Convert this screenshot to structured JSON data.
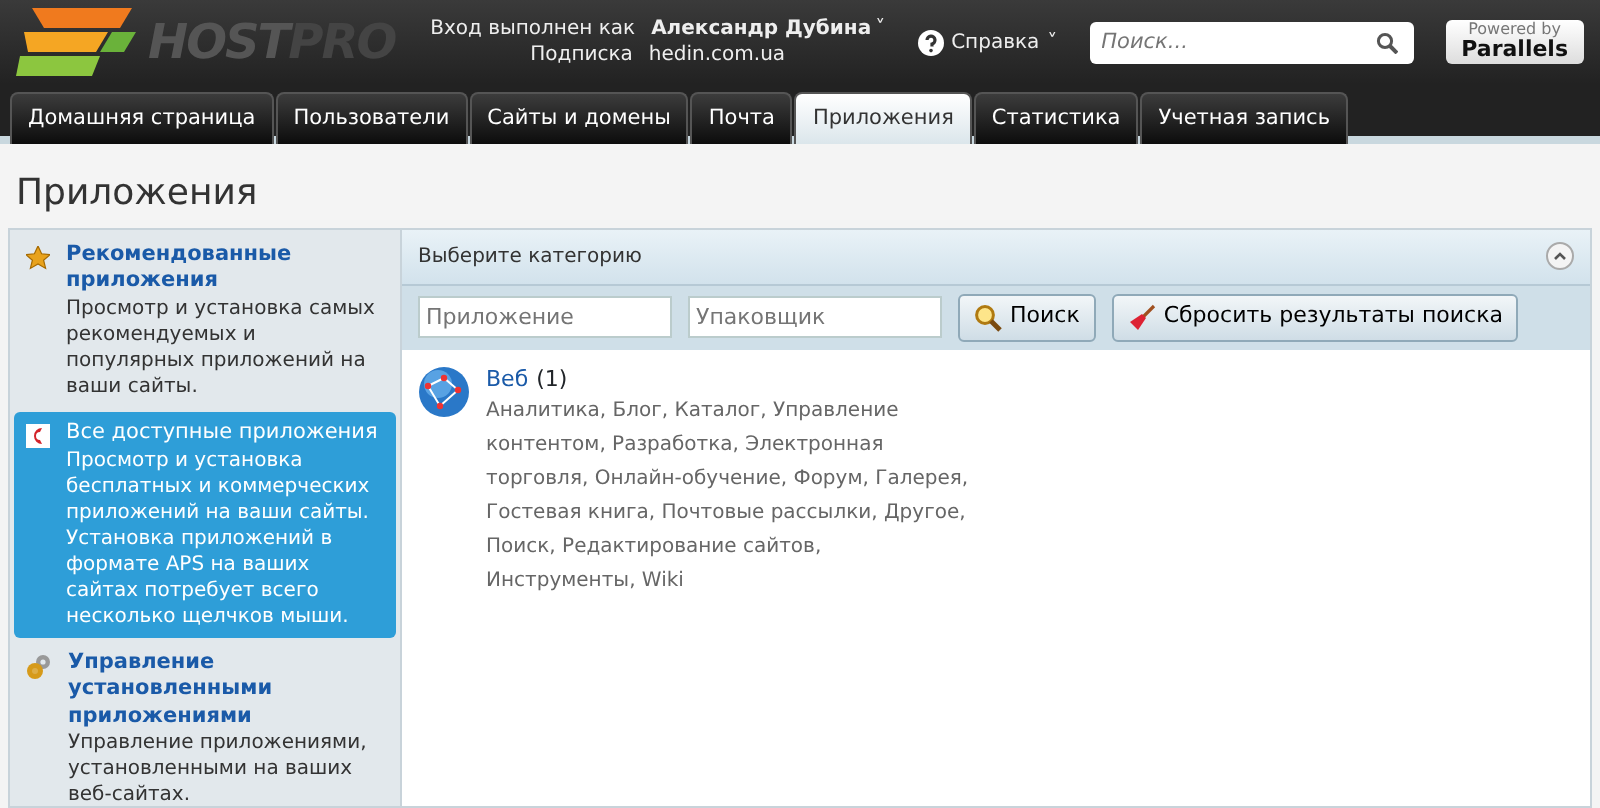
{
  "header": {
    "logo": {
      "part_1": "HOST",
      "part_2": "PRO"
    },
    "login_label": "Вход выполнен как",
    "user": "Александр Дубина",
    "user_caret": "˅",
    "subscription_label": "Подписка",
    "subscription": "hedin.com.ua",
    "help": "Справка",
    "help_caret": "˅",
    "search": {
      "placeholder": "Поиск..."
    },
    "powered": {
      "line_1": "Powered by",
      "line_2": "Parallels"
    }
  },
  "tabs": [
    {
      "label": "Домашняя страница",
      "selected": false
    },
    {
      "label": "Пользователи",
      "selected": false
    },
    {
      "label": "Сайты и домены",
      "selected": false
    },
    {
      "label": "Почта",
      "selected": false
    },
    {
      "label": "Приложения",
      "selected": true
    },
    {
      "label": "Статистика",
      "selected": false
    },
    {
      "label": "Учетная запись",
      "selected": false
    }
  ],
  "page_title": "Приложения",
  "sidebar": {
    "items": [
      {
        "kind": "star",
        "title": "Рекомендованные приложения",
        "description": "Просмотр и установка самых рекомендуемых и популярных приложений на ваши сайты.",
        "selected": false
      },
      {
        "kind": "catalog",
        "title": "Все доступные приложения",
        "description": "Просмотр и установка бесплатных и коммерческих приложений на ваши сайты. Установка приложений в формате APS на ваших сайтах потребует всего несколько щелчков мыши.",
        "selected": true
      },
      {
        "kind": "gears",
        "title": "Управление установленными приложениями",
        "description": "Управление приложениями, установленными на ваших веб-сайтах.",
        "selected": false
      }
    ]
  },
  "panel": {
    "title": "Выберите категорию",
    "filters": [
      {
        "placeholder": "Приложение"
      },
      {
        "placeholder": "Упаковщик"
      }
    ],
    "buttons": [
      {
        "kind": "search",
        "label": "Поиск"
      },
      {
        "kind": "reset",
        "label": "Сбросить результаты поиска"
      }
    ],
    "categories": [
      {
        "name": "Веб",
        "count": "(1)",
        "tags": "Аналитика, Блог, Каталог, Управление контентом, Разработка, Электронная торговля, Онлайн-обучение, Форум, Галерея, Гостевая книга, Почтовые рассылки, Другое, Поиск, Редактирование сайтов, Инструменты, Wiki"
      }
    ]
  }
}
